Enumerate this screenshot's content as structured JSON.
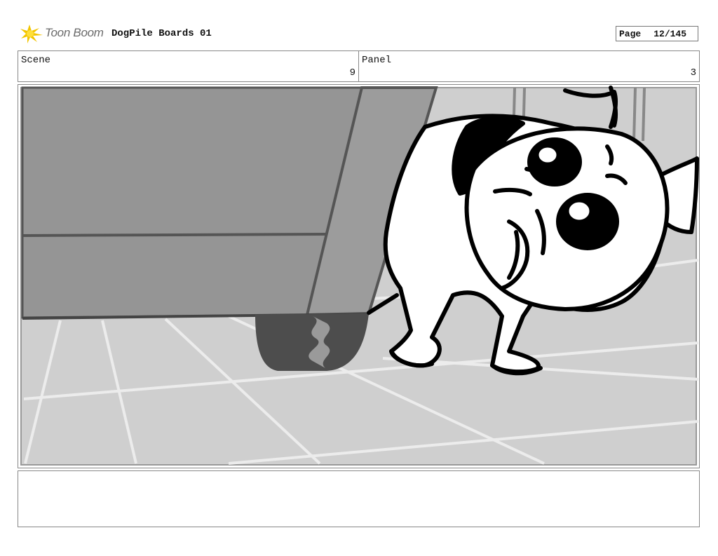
{
  "header": {
    "brand": "Toon Boom",
    "project_title": "DogPile Boards 01",
    "page_label": "Page",
    "page_number": "12/145",
    "brand_color": "#f2c500"
  },
  "scene": {
    "label": "Scene",
    "value": "9"
  },
  "panel": {
    "label": "Panel",
    "value": "3"
  },
  "artwork": {
    "icons": [
      "toon-boom-logo-icon",
      "storyboard-drawing"
    ]
  },
  "notes": {
    "text": ""
  }
}
